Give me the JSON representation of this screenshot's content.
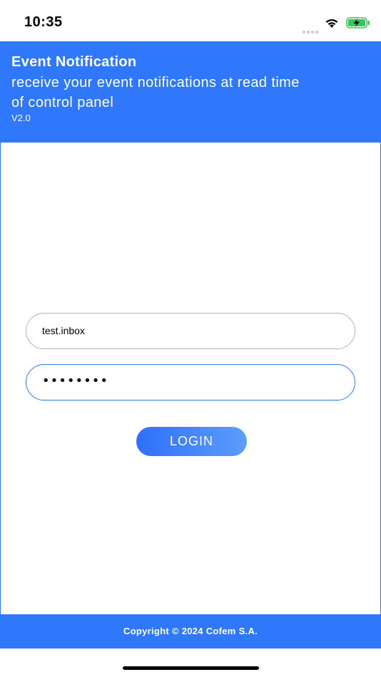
{
  "status_bar": {
    "time": "10:35",
    "icons": [
      "cellular-dots-icon",
      "wifi-icon",
      "battery-charging-icon"
    ]
  },
  "header": {
    "title": "Event Notification",
    "subtitle": "receive your event notifications at read time of control panel",
    "version": "V2.0"
  },
  "form": {
    "username_value": "test.inbox",
    "password_mask": "••••••••",
    "login_label": "LOGIN"
  },
  "footer": {
    "copyright": "Copyright © 2024 Cofem S.A."
  },
  "colors": {
    "accent": "#2f78fb",
    "field_border": "#b3b3b3",
    "button_gradient_start": "#2f6ffc",
    "button_gradient_end": "#5d9dfb",
    "battery_green": "#35c759"
  }
}
